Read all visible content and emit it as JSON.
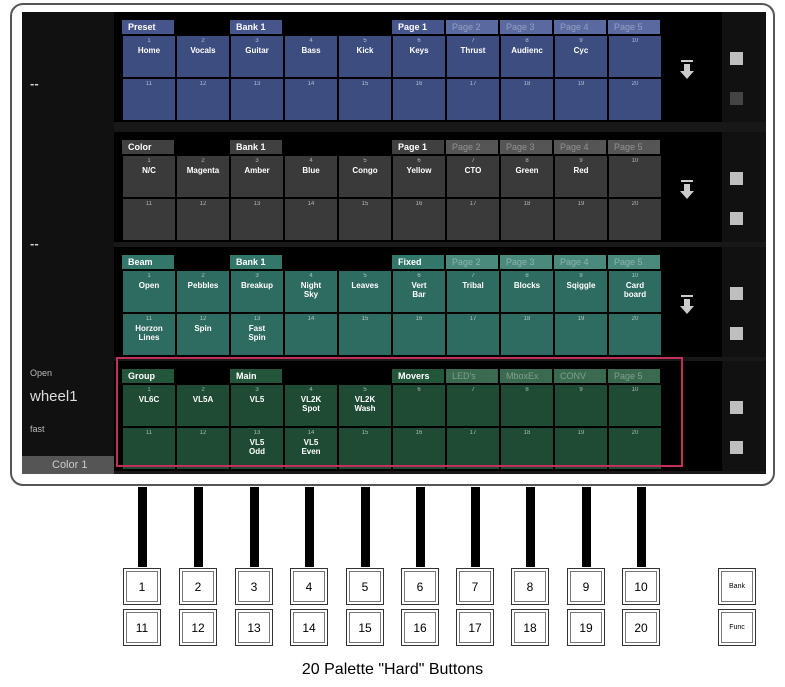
{
  "left_panel": {
    "dash1": "--",
    "dash2": "--",
    "open": "Open",
    "wheel": "wheel1",
    "fast": "fast",
    "color": "Color 1"
  },
  "sections": [
    {
      "id": "preset",
      "title": "Preset",
      "bank": "Bank 1",
      "page": "Page 1",
      "pages": [
        "Page 2",
        "Page 3",
        "Page 4",
        "Page 5"
      ],
      "color": "#3d4d80",
      "headcolor": "#46558c",
      "dimcolor": "#5a6aa0",
      "row1": [
        [
          "1",
          "Home"
        ],
        [
          "2",
          "Vocals"
        ],
        [
          "3",
          "Guitar"
        ],
        [
          "4",
          "Bass"
        ],
        [
          "5",
          "Kick"
        ],
        [
          "6",
          "Keys"
        ],
        [
          "7",
          "Thrust"
        ],
        [
          "8",
          "Audienc"
        ],
        [
          "9",
          "Cyc"
        ],
        [
          "10",
          ""
        ]
      ],
      "row2": [
        [
          "11",
          ""
        ],
        [
          "12",
          ""
        ],
        [
          "13",
          ""
        ],
        [
          "14",
          ""
        ],
        [
          "15",
          ""
        ],
        [
          "16",
          ""
        ],
        [
          "17",
          ""
        ],
        [
          "18",
          ""
        ],
        [
          "19",
          ""
        ],
        [
          "20",
          ""
        ]
      ]
    },
    {
      "id": "color",
      "title": "Color",
      "bank": "Bank 1",
      "page": "Page 1",
      "pages": [
        "Page 2",
        "Page 3",
        "Page 4",
        "Page 5"
      ],
      "color": "#3a3a3a",
      "headcolor": "#404040",
      "dimcolor": "#555",
      "row1": [
        [
          "1",
          "N/C"
        ],
        [
          "2",
          "Magenta"
        ],
        [
          "3",
          "Amber"
        ],
        [
          "4",
          "Blue"
        ],
        [
          "5",
          "Congo"
        ],
        [
          "6",
          "Yellow"
        ],
        [
          "7",
          "CTO"
        ],
        [
          "8",
          "Green"
        ],
        [
          "9",
          "Red"
        ],
        [
          "10",
          ""
        ]
      ],
      "row2": [
        [
          "11",
          ""
        ],
        [
          "12",
          ""
        ],
        [
          "13",
          ""
        ],
        [
          "14",
          ""
        ],
        [
          "15",
          ""
        ],
        [
          "16",
          ""
        ],
        [
          "17",
          ""
        ],
        [
          "18",
          ""
        ],
        [
          "19",
          ""
        ],
        [
          "20",
          ""
        ]
      ]
    },
    {
      "id": "beam",
      "title": "Beam",
      "bank": "Bank 1",
      "page": "Fixed",
      "pages": [
        "Page 2",
        "Page 3",
        "Page 4",
        "Page 5"
      ],
      "color": "#2e6b60",
      "headcolor": "#33776b",
      "dimcolor": "#4a8a7d",
      "row1": [
        [
          "1",
          "Open"
        ],
        [
          "2",
          "Pebbles"
        ],
        [
          "3",
          "Breakup"
        ],
        [
          "4",
          "Night Sky"
        ],
        [
          "5",
          "Leaves"
        ],
        [
          "6",
          "Vert Bar"
        ],
        [
          "7",
          "Tribal"
        ],
        [
          "8",
          "Blocks"
        ],
        [
          "9",
          "Sqiggle"
        ],
        [
          "10",
          "Card board"
        ]
      ],
      "row2": [
        [
          "11",
          "Horzon Lines"
        ],
        [
          "12",
          "Spin"
        ],
        [
          "13",
          "Fast Spin"
        ],
        [
          "14",
          ""
        ],
        [
          "15",
          ""
        ],
        [
          "16",
          ""
        ],
        [
          "17",
          ""
        ],
        [
          "18",
          ""
        ],
        [
          "19",
          ""
        ],
        [
          "20",
          ""
        ]
      ]
    },
    {
      "id": "group",
      "title": "Group",
      "bank": "Main",
      "page": "Movers",
      "pages": [
        "LED's",
        "MboxEx",
        "CONV",
        "Page 5"
      ],
      "color": "#1f4a33",
      "headcolor": "#23553a",
      "dimcolor": "#3a6a4f",
      "row1": [
        [
          "1",
          "VL6C"
        ],
        [
          "2",
          "VL5A"
        ],
        [
          "3",
          "VL5"
        ],
        [
          "4",
          "VL2K Spot"
        ],
        [
          "5",
          "VL2K Wash"
        ],
        [
          "6",
          ""
        ],
        [
          "7",
          ""
        ],
        [
          "8",
          ""
        ],
        [
          "9",
          ""
        ],
        [
          "10",
          ""
        ]
      ],
      "row2": [
        [
          "11",
          ""
        ],
        [
          "12",
          ""
        ],
        [
          "13",
          "VL5 Odd"
        ],
        [
          "14",
          "VL5 Even"
        ],
        [
          "15",
          ""
        ],
        [
          "16",
          ""
        ],
        [
          "17",
          ""
        ],
        [
          "18",
          ""
        ],
        [
          "19",
          ""
        ],
        [
          "20",
          ""
        ]
      ]
    }
  ],
  "hard_buttons_top": [
    "1",
    "2",
    "3",
    "4",
    "5",
    "6",
    "7",
    "8",
    "9",
    "10"
  ],
  "hard_buttons_bottom": [
    "11",
    "12",
    "13",
    "14",
    "15",
    "16",
    "17",
    "18",
    "19",
    "20"
  ],
  "side_buttons": {
    "bank": "Bank",
    "func": "Func"
  },
  "caption": "20 Palette \"Hard\" Buttons"
}
